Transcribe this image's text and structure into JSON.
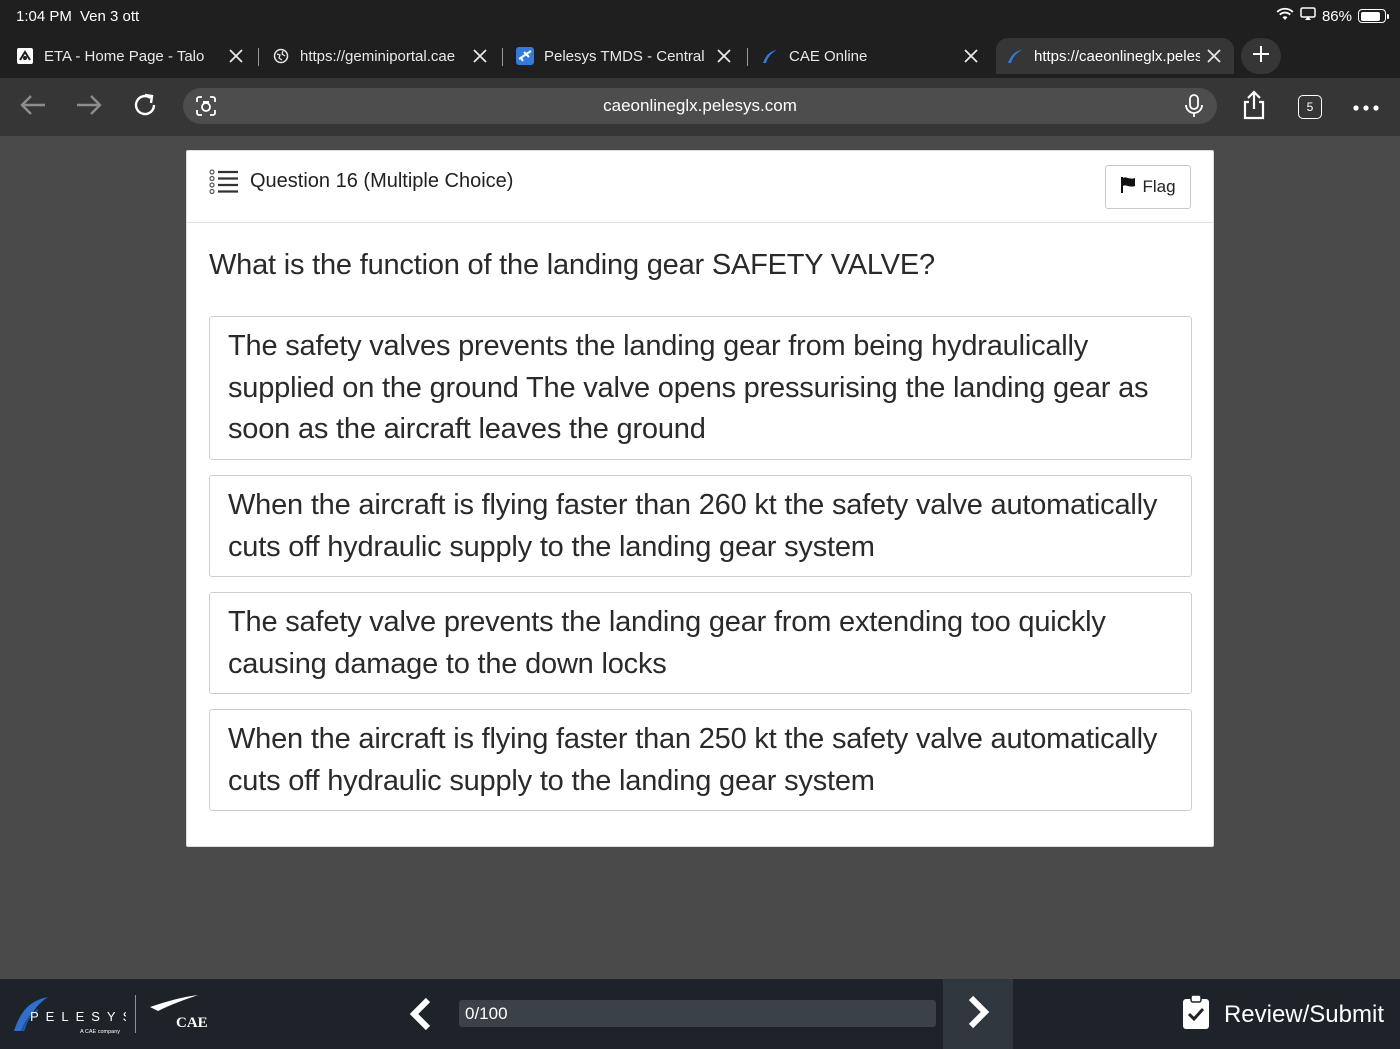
{
  "status_bar": {
    "time": "1:04 PM",
    "date": "Ven 3 ott",
    "battery_text": "86%",
    "battery_level": 0.86
  },
  "tabs": [
    {
      "title": "ETA - Home Page - Talon",
      "icon": "eta-icon"
    },
    {
      "title": "https://geminiportal.cae",
      "icon": "globe-icon"
    },
    {
      "title": "Pelesys TMDS - Central",
      "icon": "plane-icon"
    },
    {
      "title": "CAE Online",
      "icon": "pelesys-icon"
    },
    {
      "title": "https://caeonlineglx.pelesys",
      "icon": "pelesys-icon",
      "active": true
    }
  ],
  "toolbar": {
    "url": "caeonlineglx.pelesys.com",
    "tab_count": "5"
  },
  "question": {
    "header": "Question 16 (Multiple Choice)",
    "flag_label": "Flag",
    "text": "What is the function of the landing gear SAFETY VALVE?",
    "options": [
      "The safety valves prevents the landing gear from being hydraulically supplied on the ground The valve opens pressurising the landing gear as soon as the aircraft leaves the ground",
      "When the aircraft is flying faster than 260 kt the safety valve automatically cuts off hydraulic supply to the landing gear system",
      "The safety valve prevents the landing gear from extending too quickly causing damage to the down locks",
      "When the aircraft is flying faster than 250 kt the safety valve automatically cuts off hydraulic supply to the landing gear system"
    ]
  },
  "footer": {
    "brand": "PELESYS",
    "brand_sub": "A CAE company",
    "partner": "CAE",
    "progress_label": "0/100",
    "progress_fraction": 0,
    "review_label": "Review/Submit"
  }
}
